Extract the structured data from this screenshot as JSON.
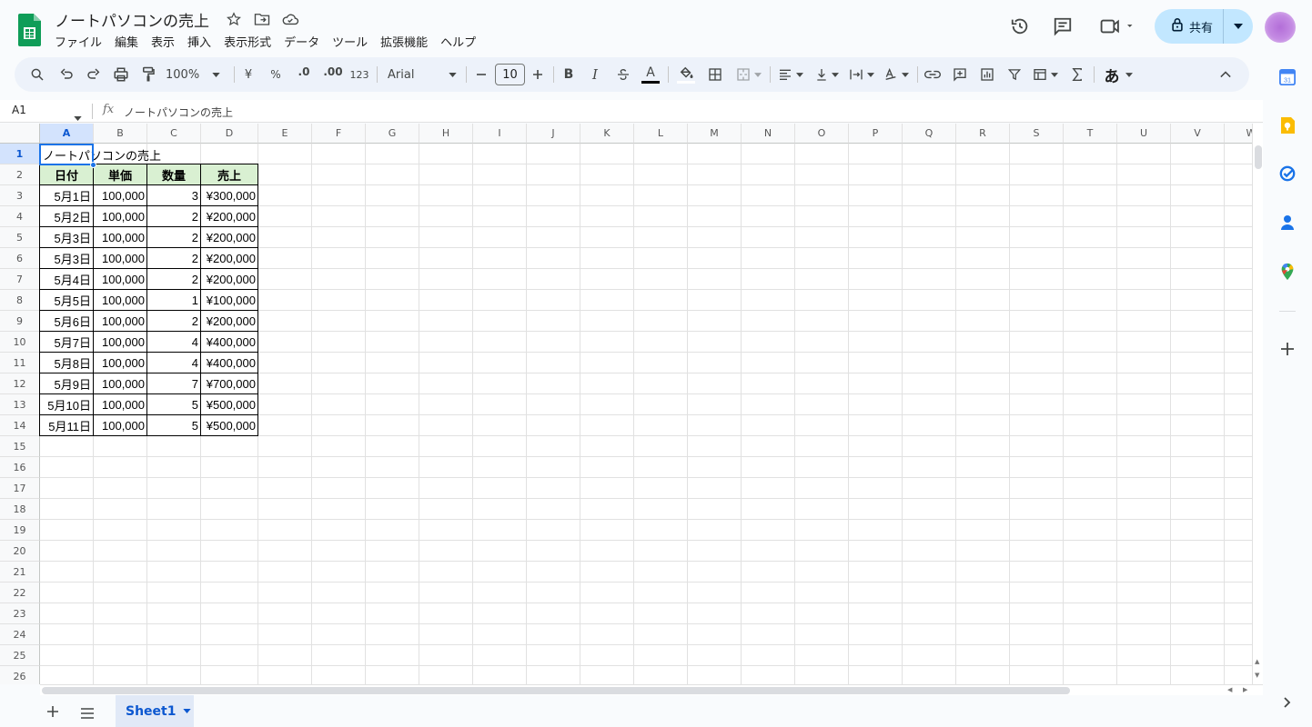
{
  "doc_title": "ノートパソコンの売上",
  "menu": [
    "ファイル",
    "編集",
    "表示",
    "挿入",
    "表示形式",
    "データ",
    "ツール",
    "拡張機能",
    "ヘルプ"
  ],
  "share_label": "共有",
  "toolbar": {
    "zoom": "100%",
    "currency": "¥",
    "percent": "%",
    "decimal_decrease": ".0",
    "decimal_increase": ".00",
    "number_format": "123",
    "font": "Arial",
    "font_size": "10",
    "bold": "B",
    "italic": "I",
    "text_color": "A",
    "input_tools": "あ"
  },
  "name_box": "A1",
  "formula_value": "ノートパソコンの売上",
  "columns": [
    "A",
    "B",
    "C",
    "D",
    "E",
    "F",
    "G",
    "H",
    "I",
    "J",
    "K",
    "L",
    "M",
    "N",
    "O",
    "P",
    "Q",
    "R",
    "S",
    "T",
    "U",
    "V",
    "W"
  ],
  "row_count": 26,
  "sheet": {
    "title_cell": "ノートパソコンの売上",
    "headers": [
      "日付",
      "単価",
      "数量",
      "売上"
    ],
    "rows": [
      [
        "5月1日",
        "100,000",
        "3",
        "¥300,000"
      ],
      [
        "5月2日",
        "100,000",
        "2",
        "¥200,000"
      ],
      [
        "5月3日",
        "100,000",
        "2",
        "¥200,000"
      ],
      [
        "5月3日",
        "100,000",
        "2",
        "¥200,000"
      ],
      [
        "5月4日",
        "100,000",
        "2",
        "¥200,000"
      ],
      [
        "5月5日",
        "100,000",
        "1",
        "¥100,000"
      ],
      [
        "5月6日",
        "100,000",
        "2",
        "¥200,000"
      ],
      [
        "5月7日",
        "100,000",
        "4",
        "¥400,000"
      ],
      [
        "5月8日",
        "100,000",
        "4",
        "¥400,000"
      ],
      [
        "5月9日",
        "100,000",
        "7",
        "¥700,000"
      ],
      [
        "5月10日",
        "100,000",
        "5",
        "¥500,000"
      ],
      [
        "5月11日",
        "100,000",
        "5",
        "¥500,000"
      ]
    ]
  },
  "sheet_tab": "Sheet1",
  "colors": {
    "accent": "#1a73e8",
    "header_fill": "#d9f0d2",
    "share_bg": "#c2e7ff",
    "sheets_green": "#0f9d58"
  }
}
